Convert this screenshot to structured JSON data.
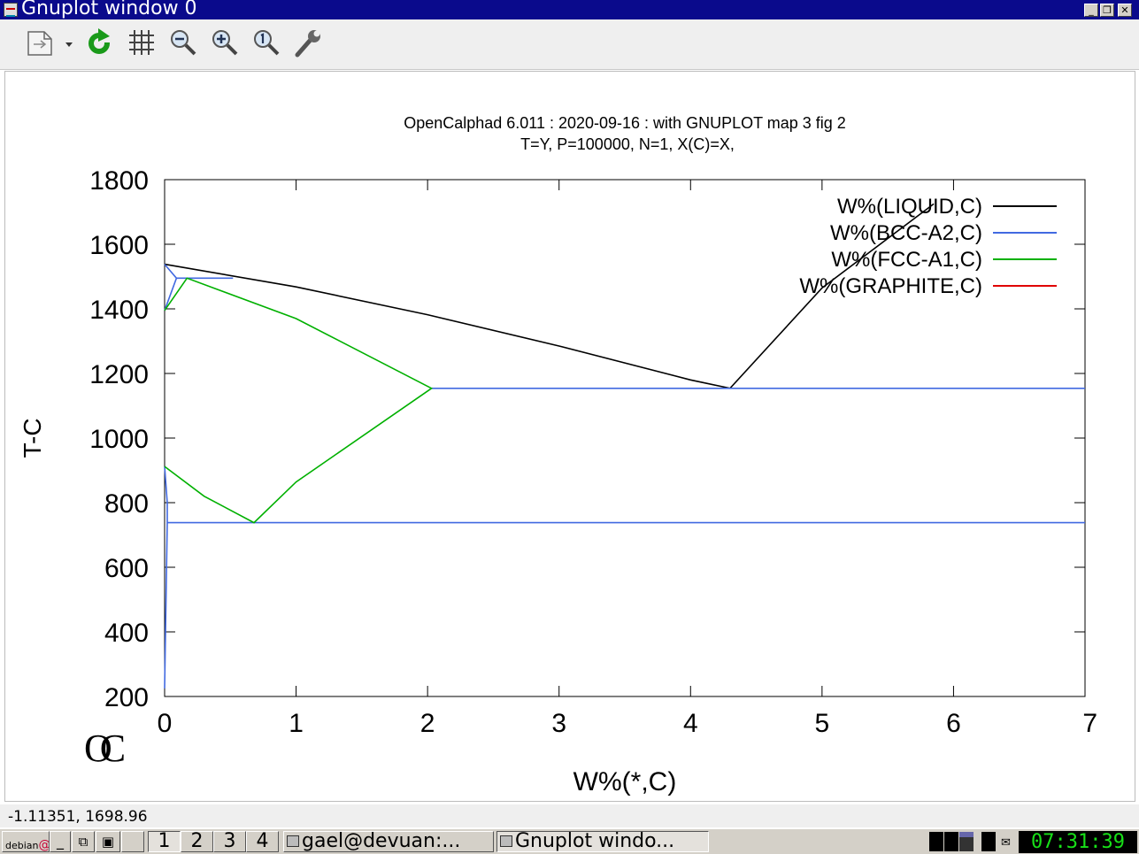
{
  "window": {
    "title": "Gnuplot window 0"
  },
  "toolbar": {
    "buttons": [
      "copy-dropdown",
      "replot",
      "grid",
      "zoom-out",
      "zoom-in",
      "zoom-fit",
      "settings"
    ]
  },
  "chart_data": {
    "type": "line",
    "title": "OpenCalphad   6.011 :  2020-09-16 : with GNUPLOT map 3 fig 2",
    "subtitle": "T=Y,  P=100000, N=1, X(C)=X,",
    "xlabel": "W%(*,C)",
    "ylabel": "T-C",
    "xlim": [
      0,
      7
    ],
    "ylim": [
      200,
      1800
    ],
    "xticks": [
      "0",
      "1",
      "2",
      "3",
      "4",
      "5",
      "6",
      "7"
    ],
    "yticks": [
      "200",
      "400",
      "600",
      "800",
      "1000",
      "1200",
      "1400",
      "1600",
      "1800"
    ],
    "legend_position": "top-right",
    "logo": "OC",
    "series": [
      {
        "name": "W%(LIQUID,C)",
        "color": "#000000",
        "segments": [
          [
            [
              0,
              1538
            ],
            [
              1.0,
              1468
            ],
            [
              2.0,
              1382
            ],
            [
              3.0,
              1285
            ],
            [
              4.0,
              1180
            ],
            [
              4.3,
              1154
            ],
            [
              5.0,
              1465
            ],
            [
              5.85,
              1725
            ]
          ]
        ]
      },
      {
        "name": "W%(BCC-A2,C)",
        "color": "#4169e1",
        "segments": [
          [
            [
              0,
              1538
            ],
            [
              0.09,
              1495
            ],
            [
              0,
              1395
            ]
          ],
          [
            [
              0.09,
              1495
            ],
            [
              0.52,
              1495
            ]
          ],
          [
            [
              2.03,
              1154
            ],
            [
              7,
              1154
            ]
          ],
          [
            [
              0,
              912
            ],
            [
              0.02,
              800
            ],
            [
              0.02,
              738
            ],
            [
              0,
              225
            ]
          ],
          [
            [
              0.02,
              738
            ],
            [
              7,
              738
            ]
          ]
        ]
      },
      {
        "name": "W%(FCC-A1,C)",
        "color": "#00b000",
        "segments": [
          [
            [
              0,
              1395
            ],
            [
              0.17,
              1495
            ],
            [
              1.0,
              1370
            ],
            [
              2.03,
              1154
            ],
            [
              1.0,
              864
            ],
            [
              0.68,
              738
            ],
            [
              0.3,
              820
            ],
            [
              0,
              912
            ]
          ]
        ]
      },
      {
        "name": "W%(GRAPHITE,C)",
        "color": "#e00000",
        "segments": []
      }
    ]
  },
  "status": {
    "coords": "-1.11351,  1698.96"
  },
  "taskbar": {
    "debian_label": "debian",
    "workspaces": [
      "1",
      "2",
      "3",
      "4"
    ],
    "tasks": [
      "gael@devuan:...",
      "Gnuplot windo..."
    ],
    "clock": "07:31:39"
  }
}
